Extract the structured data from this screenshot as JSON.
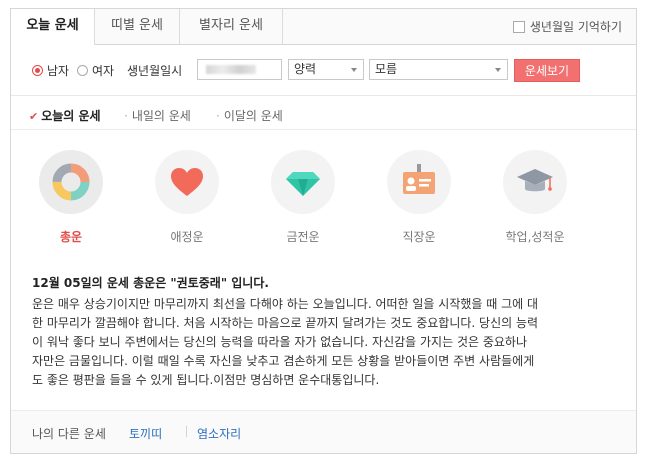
{
  "tabs": [
    {
      "label": "오늘 운세",
      "active": true
    },
    {
      "label": "띠별 운세",
      "active": false
    },
    {
      "label": "별자리 운세",
      "active": false
    }
  ],
  "remember_label": "생년월일 기억하기",
  "form": {
    "male_label": "남자",
    "female_label": "여자",
    "gender_selected": "남자",
    "birth_label": "생년월일시",
    "calendar_value": "양력",
    "time_value": "모름",
    "submit_label": "운세보기"
  },
  "subtabs": [
    {
      "label": "오늘의 운세",
      "active": true
    },
    {
      "label": "내일의 운세",
      "active": false
    },
    {
      "label": "이달의 운세",
      "active": false
    }
  ],
  "categories": [
    {
      "label": "총운",
      "icon": "pie-chart-icon",
      "active": true
    },
    {
      "label": "애정운",
      "icon": "heart-icon",
      "active": false
    },
    {
      "label": "금전운",
      "icon": "diamond-icon",
      "active": false
    },
    {
      "label": "직장운",
      "icon": "id-badge-icon",
      "active": false
    },
    {
      "label": "학업,성적운",
      "icon": "graduation-cap-icon",
      "active": false
    }
  ],
  "fortune": {
    "title": "12월 05일의 운세 총운은 \"권토중래\" 입니다.",
    "lines": [
      "운은 매우 상승기이지만 마무리까지 최선을 다해야 하는 오늘입니다. 어떠한 일을 시작했을 때 그에 대",
      "한 마무리가 깔끔해야 합니다. 처음 시작하는 마음으로 끝까지 달려가는 것도 중요합니다. 당신의 능력",
      "이 워낙 좋다 보니 주변에서는 당신의 능력을 따라올 자가 없습니다. 자신감을 가지는 것은 중요하나",
      "자만은 금물입니다. 이럴 때일 수록 자신을 낮추고 겸손하게 모든 상황을 받아들이면 주변 사람들에게",
      "도 좋은 평판을 들을 수 있게 됩니다.이점만 명심하면 운수대통입니다."
    ]
  },
  "footer": {
    "label": "나의 다른 운세",
    "link1": "토끼띠",
    "link2": "염소자리"
  },
  "colors": {
    "accent": "#e34b4b",
    "button": "#f27170",
    "link": "#2f6fbf"
  }
}
